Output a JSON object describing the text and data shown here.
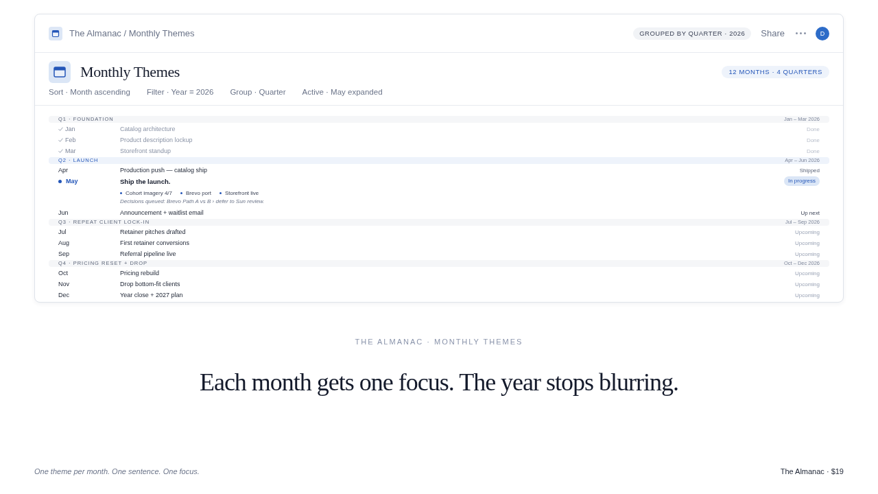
{
  "breadcrumb": "The Almanac / Monthly Themes",
  "grouping_badge": "GROUPED BY QUARTER · 2026",
  "share": "Share",
  "avatar": "D",
  "title": "Monthly Themes",
  "count_badge": "12 MONTHS · 4 QUARTERS",
  "view_settings": [
    "Sort · Month ascending",
    "Filter · Year = 2026",
    "Group · Quarter",
    "Active · May expanded"
  ],
  "quarters": [
    {
      "label": "Q1 · FOUNDATION",
      "range": "Jan – Mar 2026",
      "current": false,
      "months": [
        {
          "month": "Jan",
          "theme": "Catalog architecture",
          "status": "Done",
          "kind": "done"
        },
        {
          "month": "Feb",
          "theme": "Product description lockup",
          "status": "Done",
          "kind": "done"
        },
        {
          "month": "Mar",
          "theme": "Storefront standup",
          "status": "Done",
          "kind": "done"
        }
      ]
    },
    {
      "label": "Q2 · LAUNCH",
      "range": "Apr – Jun 2026",
      "current": true,
      "months": [
        {
          "month": "Apr",
          "theme": "Production push — catalog ship",
          "status": "Shipped",
          "kind": "shipped"
        },
        {
          "month": "May",
          "theme": "Ship the launch.",
          "status": "In progress",
          "kind": "current",
          "details": {
            "items": [
              "Cohort imagery 4/7",
              "Brevo port",
              "Storefront live"
            ],
            "note": "Decisions queued: Brevo Path A vs B › defer to Sun review."
          }
        },
        {
          "month": "Jun",
          "theme": "Announcement + waitlist email",
          "status": "Up next",
          "kind": "next"
        }
      ]
    },
    {
      "label": "Q3 · REPEAT CLIENT LOCK-IN",
      "range": "Jul – Sep 2026",
      "current": false,
      "months": [
        {
          "month": "Jul",
          "theme": "Retainer pitches drafted",
          "status": "Upcoming",
          "kind": "upcoming"
        },
        {
          "month": "Aug",
          "theme": "First retainer conversions",
          "status": "Upcoming",
          "kind": "upcoming"
        },
        {
          "month": "Sep",
          "theme": "Referral pipeline live",
          "status": "Upcoming",
          "kind": "upcoming"
        }
      ]
    },
    {
      "label": "Q4 · PRICING RESET + DROP",
      "range": "Oct – Dec 2026",
      "current": false,
      "months": [
        {
          "month": "Oct",
          "theme": "Pricing rebuild",
          "status": "Upcoming",
          "kind": "upcoming"
        },
        {
          "month": "Nov",
          "theme": "Drop bottom-fit clients",
          "status": "Upcoming",
          "kind": "upcoming"
        },
        {
          "month": "Dec",
          "theme": "Year close + 2027 plan",
          "status": "Upcoming",
          "kind": "upcoming"
        }
      ]
    }
  ],
  "tagline": "THE ALMANAC · MONTHLY THEMES",
  "headline": "Each month gets one focus. The year stops blurring.",
  "footer": {
    "note": "One theme per month. One sentence. One focus.",
    "product": "The Almanac · $19"
  }
}
